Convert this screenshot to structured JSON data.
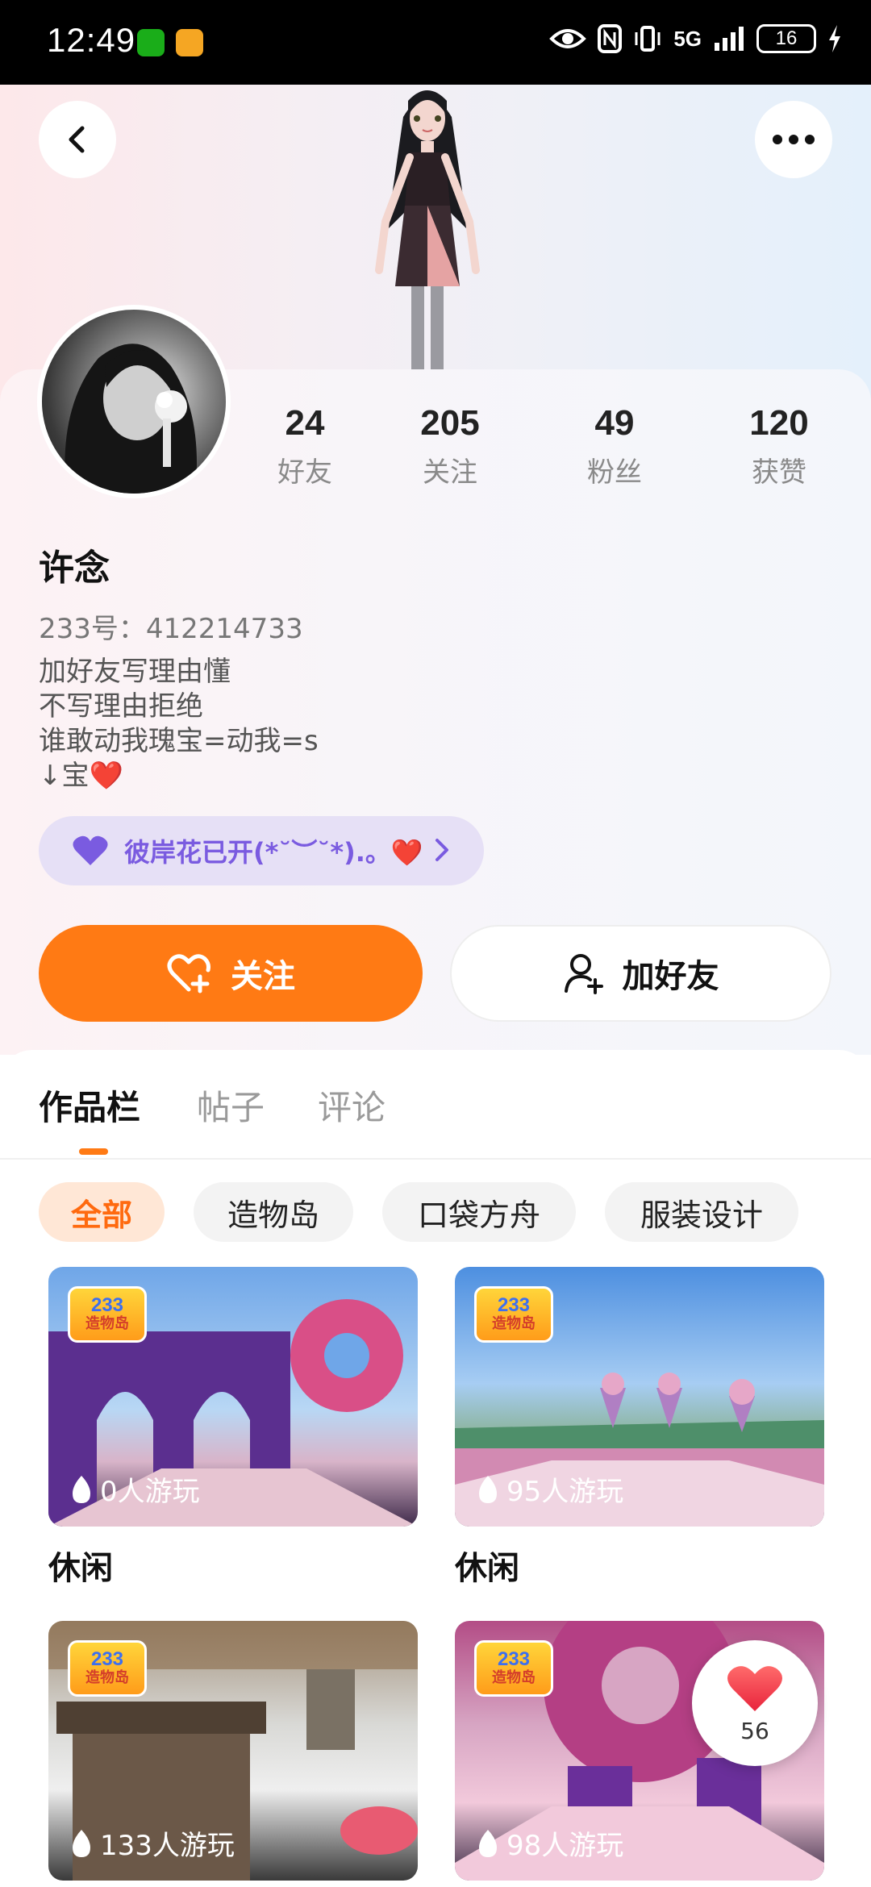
{
  "status_bar": {
    "time": "12:49",
    "network": "5G",
    "battery": "16"
  },
  "profile": {
    "name": "许念",
    "id_line": "233号：412214733",
    "bio": [
      "加好友写理由懂",
      "不写理由拒绝",
      "谁敢动我瑰宝=动我=s",
      "↓宝❤️"
    ],
    "stats": [
      {
        "value": "24",
        "label": "好友"
      },
      {
        "value": "205",
        "label": "关注"
      },
      {
        "value": "49",
        "label": "粉丝"
      },
      {
        "value": "120",
        "label": "获赞"
      }
    ],
    "tag": "彼岸花已开(*˘︶˘*).。❤️"
  },
  "actions": {
    "follow": "关注",
    "add_friend": "加好友"
  },
  "tabs": [
    "作品栏",
    "帖子",
    "评论"
  ],
  "filters": [
    "全部",
    "造物岛",
    "口袋方舟",
    "服装设计"
  ],
  "games": [
    {
      "plays": "0人游玩",
      "category": "休闲",
      "logo_top": "233",
      "logo_bottom": "造物岛"
    },
    {
      "plays": "95人游玩",
      "category": "休闲",
      "logo_top": "233",
      "logo_bottom": "造物岛"
    },
    {
      "plays": "133人游玩",
      "category": "",
      "logo_top": "233",
      "logo_bottom": "造物岛"
    },
    {
      "plays": "98人游玩",
      "category": "",
      "logo_top": "233",
      "logo_bottom": "造物岛"
    }
  ],
  "like_count": "56",
  "colors": {
    "accent": "#ff7a14",
    "tag_text": "#7a5be0",
    "tag_bg": "#e6e0f6"
  },
  "icons": [
    "back-icon",
    "more-icon",
    "heart-plus-icon",
    "user-plus-icon",
    "flame-icon",
    "heart-icon",
    "chevron-right-icon"
  ]
}
